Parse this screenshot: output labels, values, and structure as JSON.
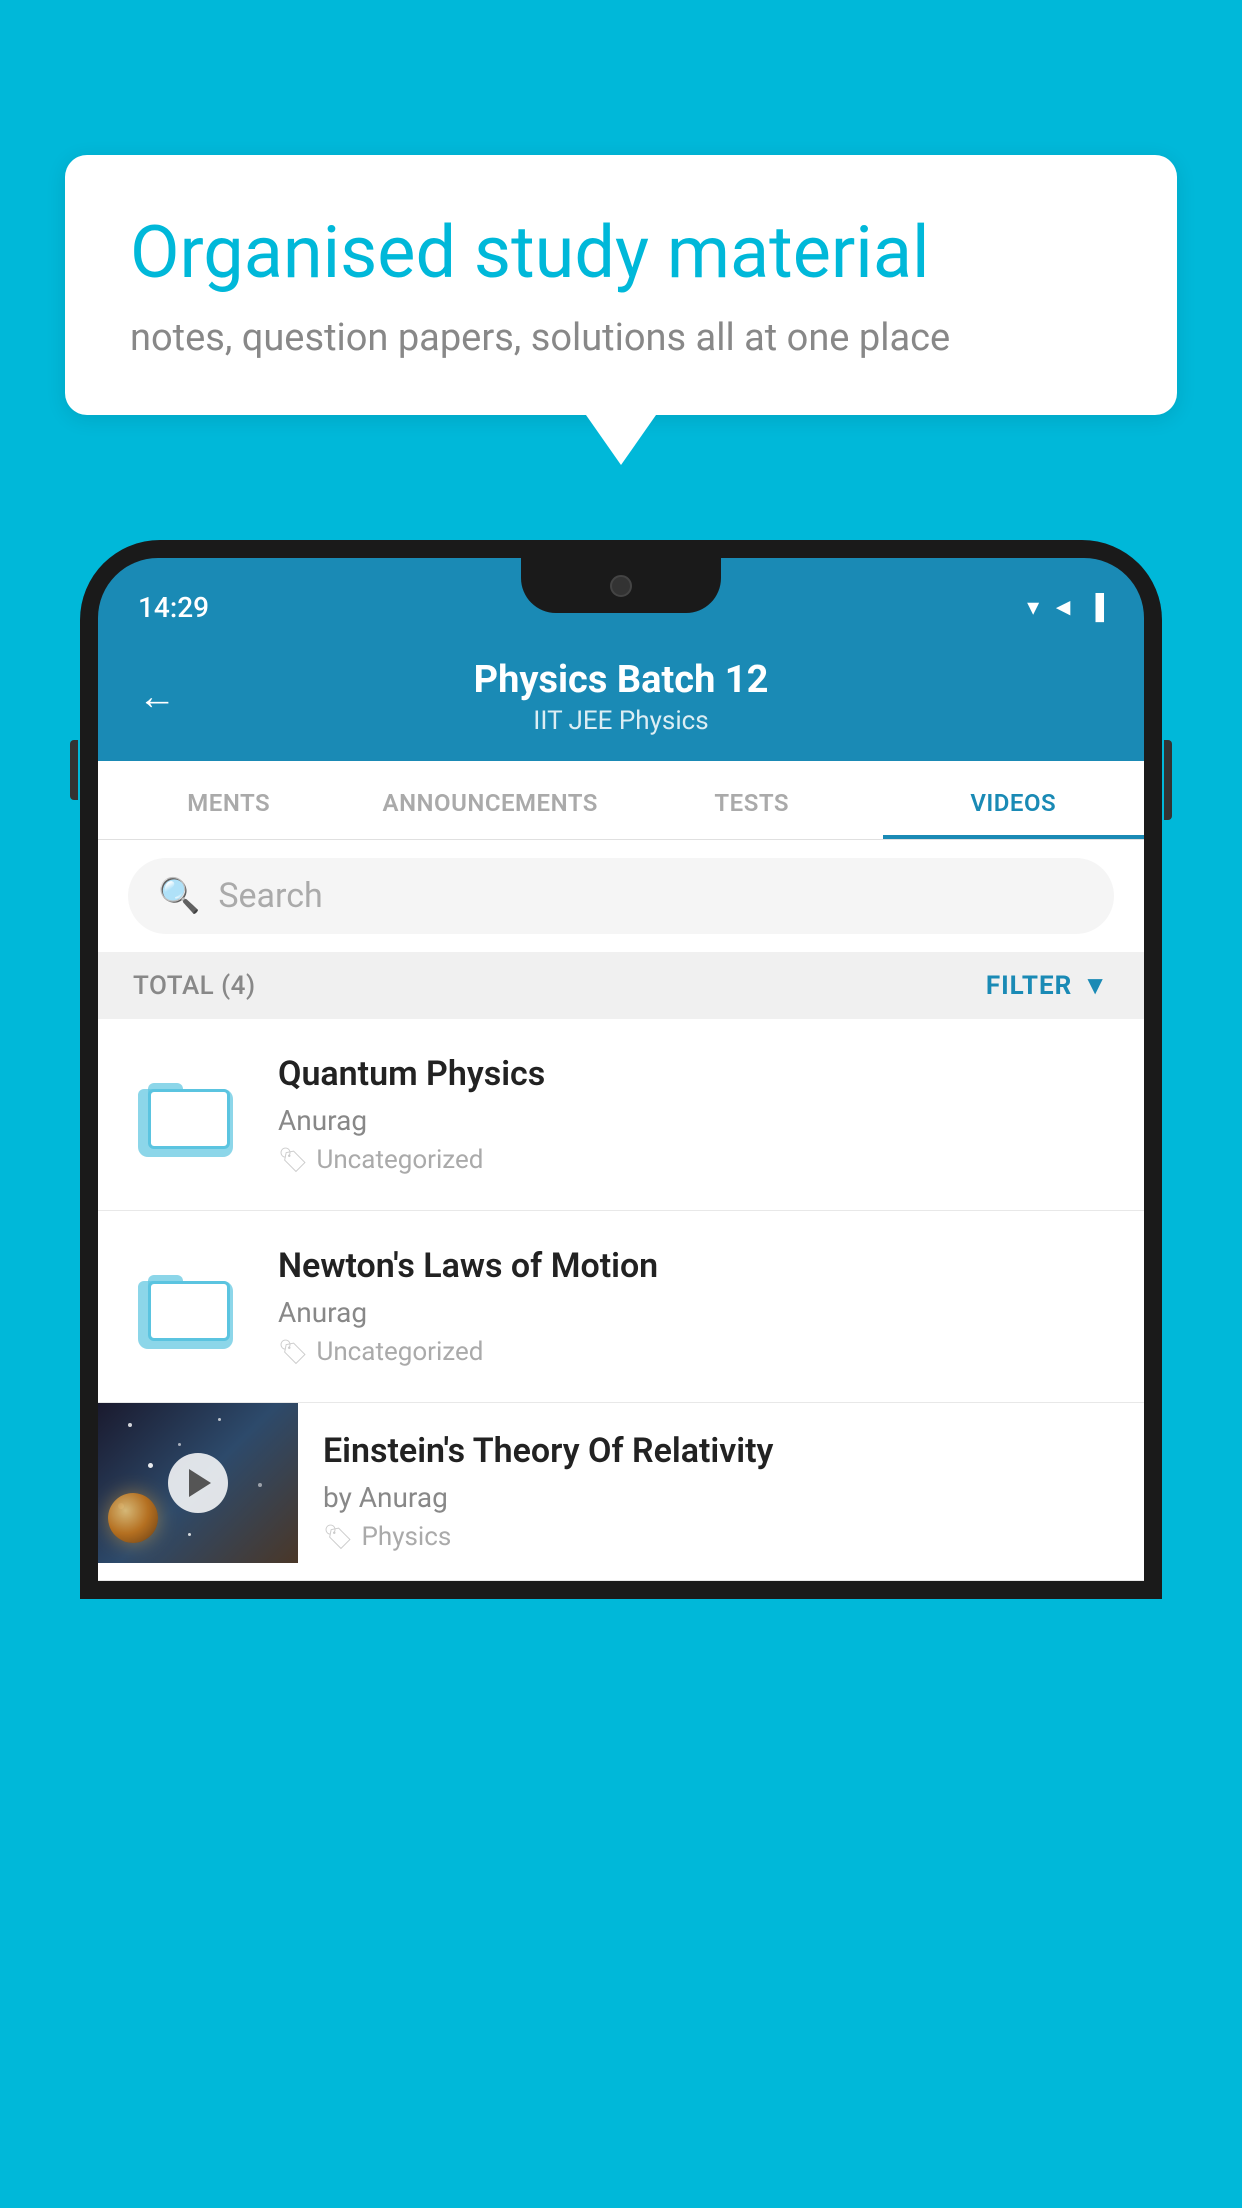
{
  "background_color": "#00B8D9",
  "speech_bubble": {
    "title": "Organised study material",
    "subtitle": "notes, question papers, solutions all at one place"
  },
  "phone": {
    "status_bar": {
      "time": "14:29"
    },
    "header": {
      "title": "Physics Batch 12",
      "subtitle": "IIT JEE   Physics",
      "back_label": "←"
    },
    "tabs": [
      {
        "label": "MENTS",
        "active": false
      },
      {
        "label": "ANNOUNCEMENTS",
        "active": false
      },
      {
        "label": "TESTS",
        "active": false
      },
      {
        "label": "VIDEOS",
        "active": true
      }
    ],
    "search": {
      "placeholder": "Search"
    },
    "filter_bar": {
      "total_label": "TOTAL (4)",
      "filter_label": "FILTER"
    },
    "videos": [
      {
        "id": 1,
        "title": "Quantum Physics",
        "author": "Anurag",
        "tag": "Uncategorized",
        "type": "folder"
      },
      {
        "id": 2,
        "title": "Newton's Laws of Motion",
        "author": "Anurag",
        "tag": "Uncategorized",
        "type": "folder"
      },
      {
        "id": 3,
        "title": "Einstein's Theory Of Relativity",
        "author": "by Anurag",
        "tag": "Physics",
        "type": "video"
      }
    ]
  }
}
